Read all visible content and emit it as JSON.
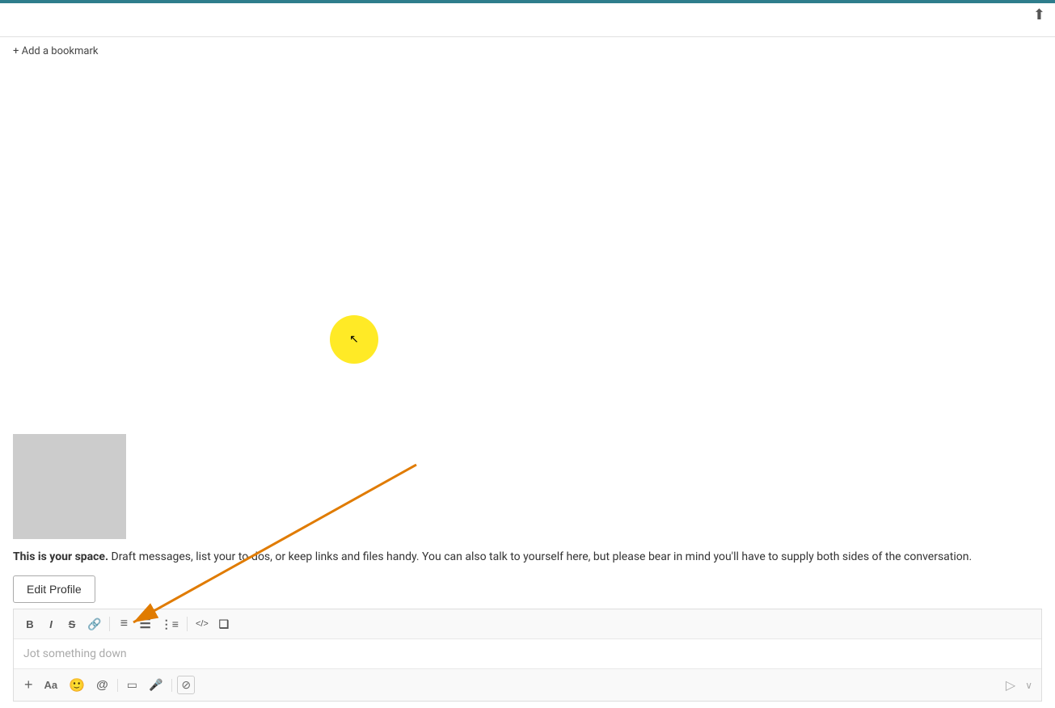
{
  "topBar": {
    "color": "#2e7d8c"
  },
  "topRightIcon": {
    "symbol": "⬆",
    "label": "upload-icon"
  },
  "bookmarkBar": {
    "addLabel": "+ Add a bookmark"
  },
  "profile": {
    "description_bold": "This is your space.",
    "description_rest": " Draft messages, list your to-dos, or keep links and files handy. You can also talk to yourself here, but please bear in mind you'll have to supply both sides of the conversation.",
    "editButtonLabel": "Edit Profile"
  },
  "composer": {
    "toolbar": {
      "boldLabel": "B",
      "italicLabel": "I",
      "strikeLabel": "S",
      "linkLabel": "🔗",
      "bulletListLabel": "≡",
      "numberedListLabel": "☰",
      "orderedListLabel": "⋮",
      "codeLabel": "</>",
      "blockquoteLabel": "❝"
    },
    "placeholder": "Jot something down",
    "bottomBar": {
      "plusLabel": "+",
      "formatLabel": "Aa",
      "emojiLabel": "☺",
      "mentionLabel": "@",
      "screenLabel": "▭",
      "micLabel": "🎤",
      "codeShortcutLabel": "⊘",
      "sendLabel": "▷",
      "chevronLabel": "∨"
    }
  }
}
